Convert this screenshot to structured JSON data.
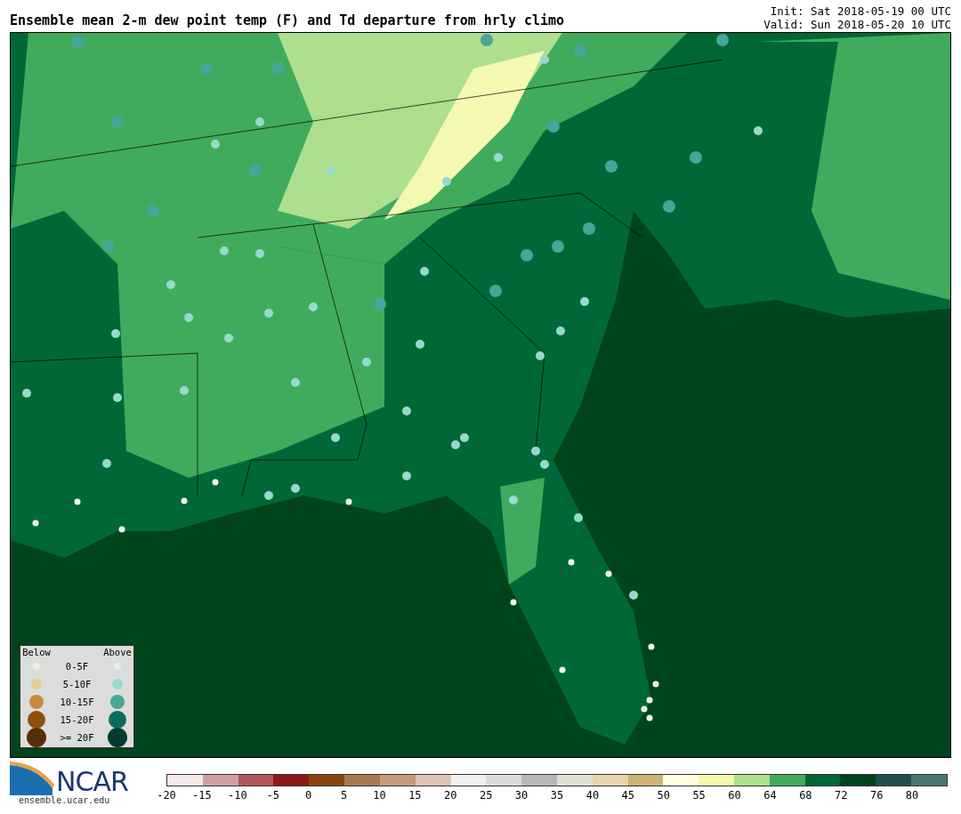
{
  "title": "Ensemble mean 2-m dew point temp (F) and Td departure from hrly climo",
  "init": "Init: Sat 2018-05-19 00 UTC",
  "valid": "Valid: Sun 2018-05-20 10 UTC",
  "legend": {
    "below_header": "Below",
    "above_header": "Above",
    "rows": [
      {
        "label": "0-5F",
        "below": {
          "color": "#f5ebdc"
        },
        "above": {
          "color": "#dff2f0"
        }
      },
      {
        "label": "5-10F",
        "below": {
          "color": "#e8cf8f"
        },
        "above": {
          "color": "#98d9ce"
        }
      },
      {
        "label": "10-15F",
        "below": {
          "color": "#c68a3d"
        },
        "above": {
          "color": "#48a597"
        }
      },
      {
        "label": "15-20F",
        "below": {
          "color": "#8c510a"
        },
        "above": {
          "color": "#0a6b60"
        }
      },
      {
        "label": ">= 20F",
        "below": {
          "color": "#543005"
        },
        "above": {
          "color": "#003c30"
        }
      }
    ]
  },
  "logo": {
    "name": "NCAR",
    "url": "ensemble.ucar.edu"
  },
  "colorbar": {
    "segments": [
      {
        "color": "#f5e8e8"
      },
      {
        "color": "#d0a0a0"
      },
      {
        "color": "#b05858"
      },
      {
        "color": "#8b1a1a"
      },
      {
        "color": "#8b4513"
      },
      {
        "color": "#a8784f"
      },
      {
        "color": "#c49a7a"
      },
      {
        "color": "#dcc4b2"
      },
      {
        "color": "#f0f0f0"
      },
      {
        "color": "#dcdcdc"
      },
      {
        "color": "#b8b8b8"
      },
      {
        "color": "#e0e0d0"
      },
      {
        "color": "#e6d6aa"
      },
      {
        "color": "#cdb477"
      },
      {
        "color": "#ffffe0"
      },
      {
        "color": "#f5f8b0"
      },
      {
        "color": "#addf8e"
      },
      {
        "color": "#41ab5d"
      },
      {
        "color": "#006837"
      },
      {
        "color": "#00441b"
      },
      {
        "color": "#1d4f50"
      },
      {
        "color": "#4a7674"
      }
    ],
    "ticks": [
      "-20",
      "-15",
      "-10",
      "-5",
      "0",
      "5",
      "10",
      "15",
      "20",
      "25",
      "30",
      "35",
      "40",
      "45",
      "50",
      "55",
      "60",
      "64",
      "68",
      "72",
      "76",
      "80"
    ]
  }
}
